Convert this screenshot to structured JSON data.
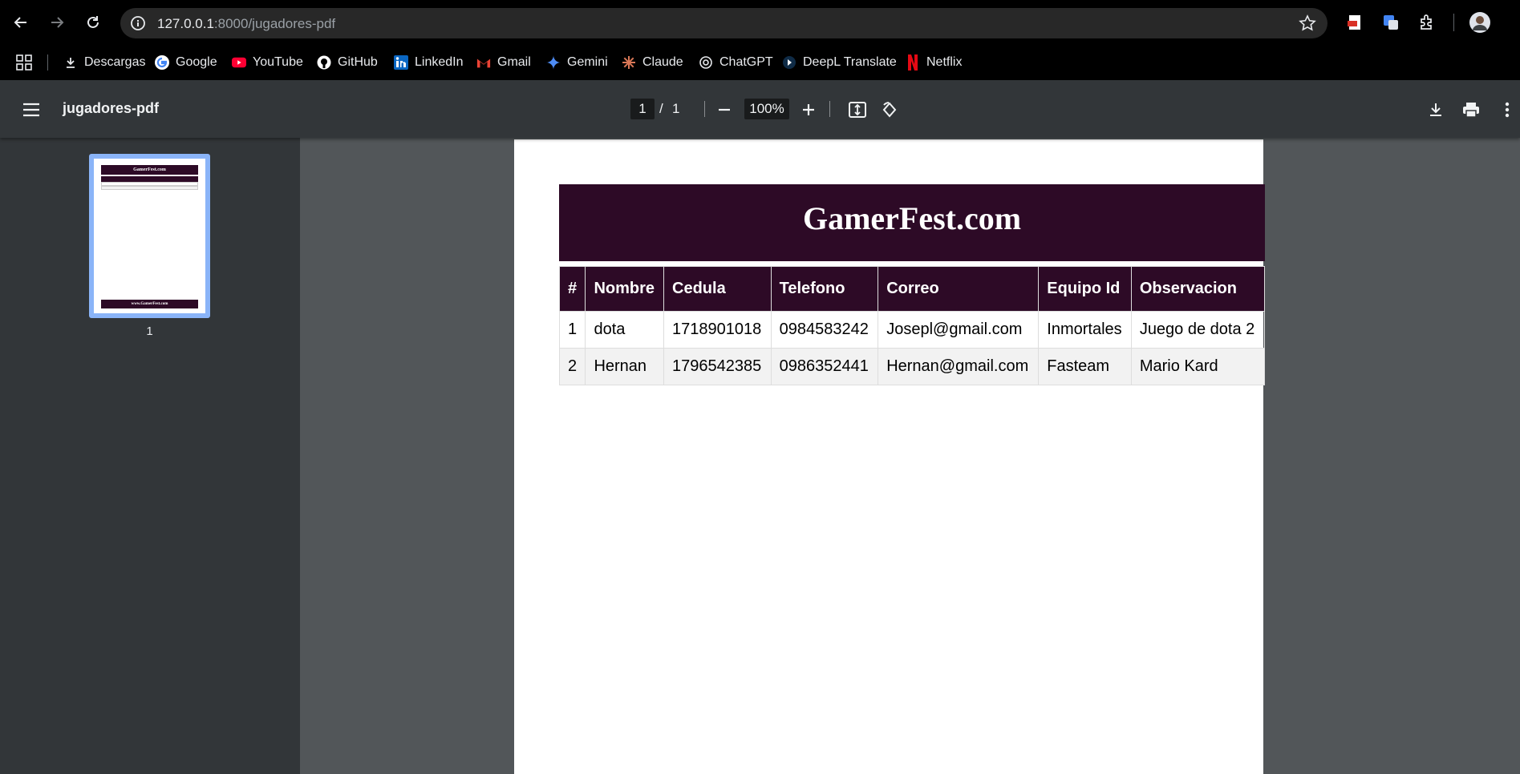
{
  "browser": {
    "url_host": "127.0.0.1",
    "url_rest": ":8000/jugadores-pdf"
  },
  "bookmarks": [
    {
      "label": "Descargas",
      "icon": "download-icon"
    },
    {
      "label": "Google",
      "icon": "google-icon"
    },
    {
      "label": "YouTube",
      "icon": "youtube-icon"
    },
    {
      "label": "GitHub",
      "icon": "github-icon"
    },
    {
      "label": "LinkedIn",
      "icon": "linkedin-icon"
    },
    {
      "label": "Gmail",
      "icon": "gmail-icon"
    },
    {
      "label": "Gemini",
      "icon": "gemini-icon"
    },
    {
      "label": "Claude",
      "icon": "claude-icon"
    },
    {
      "label": "ChatGPT",
      "icon": "chatgpt-icon"
    },
    {
      "label": "DeepL Translate",
      "icon": "deepl-icon"
    },
    {
      "label": "Netflix",
      "icon": "netflix-icon"
    }
  ],
  "pdf_toolbar": {
    "title": "jugadores-pdf",
    "current_page": "1",
    "page_separator": "/",
    "total_pages": "1",
    "zoom": "100%"
  },
  "sidebar": {
    "thumbnail_label": "1",
    "thumbnail_header": "GamerFest.com",
    "thumbnail_footer": "www.GamerFest.com"
  },
  "document": {
    "header": "GamerFest.com",
    "columns": [
      "#",
      "Nombre",
      "Cedula",
      "Telefono",
      "Correo",
      "Equipo Id",
      "Observacion"
    ],
    "rows": [
      [
        "1",
        "dota",
        "1718901018",
        "0984583242",
        "Josepl@gmail.com",
        "Inmortales",
        "Juego de dota 2"
      ],
      [
        "2",
        "Hernan",
        "1796542385",
        "0986352441",
        "Hernan@gmail.com",
        "Fasteam",
        "Mario Kard"
      ]
    ]
  },
  "colors": {
    "header_bg": "#2d0a26",
    "toolbar_bg": "#323639",
    "viewer_bg": "#525659",
    "thumbnail_border": "#8ab4f8"
  }
}
